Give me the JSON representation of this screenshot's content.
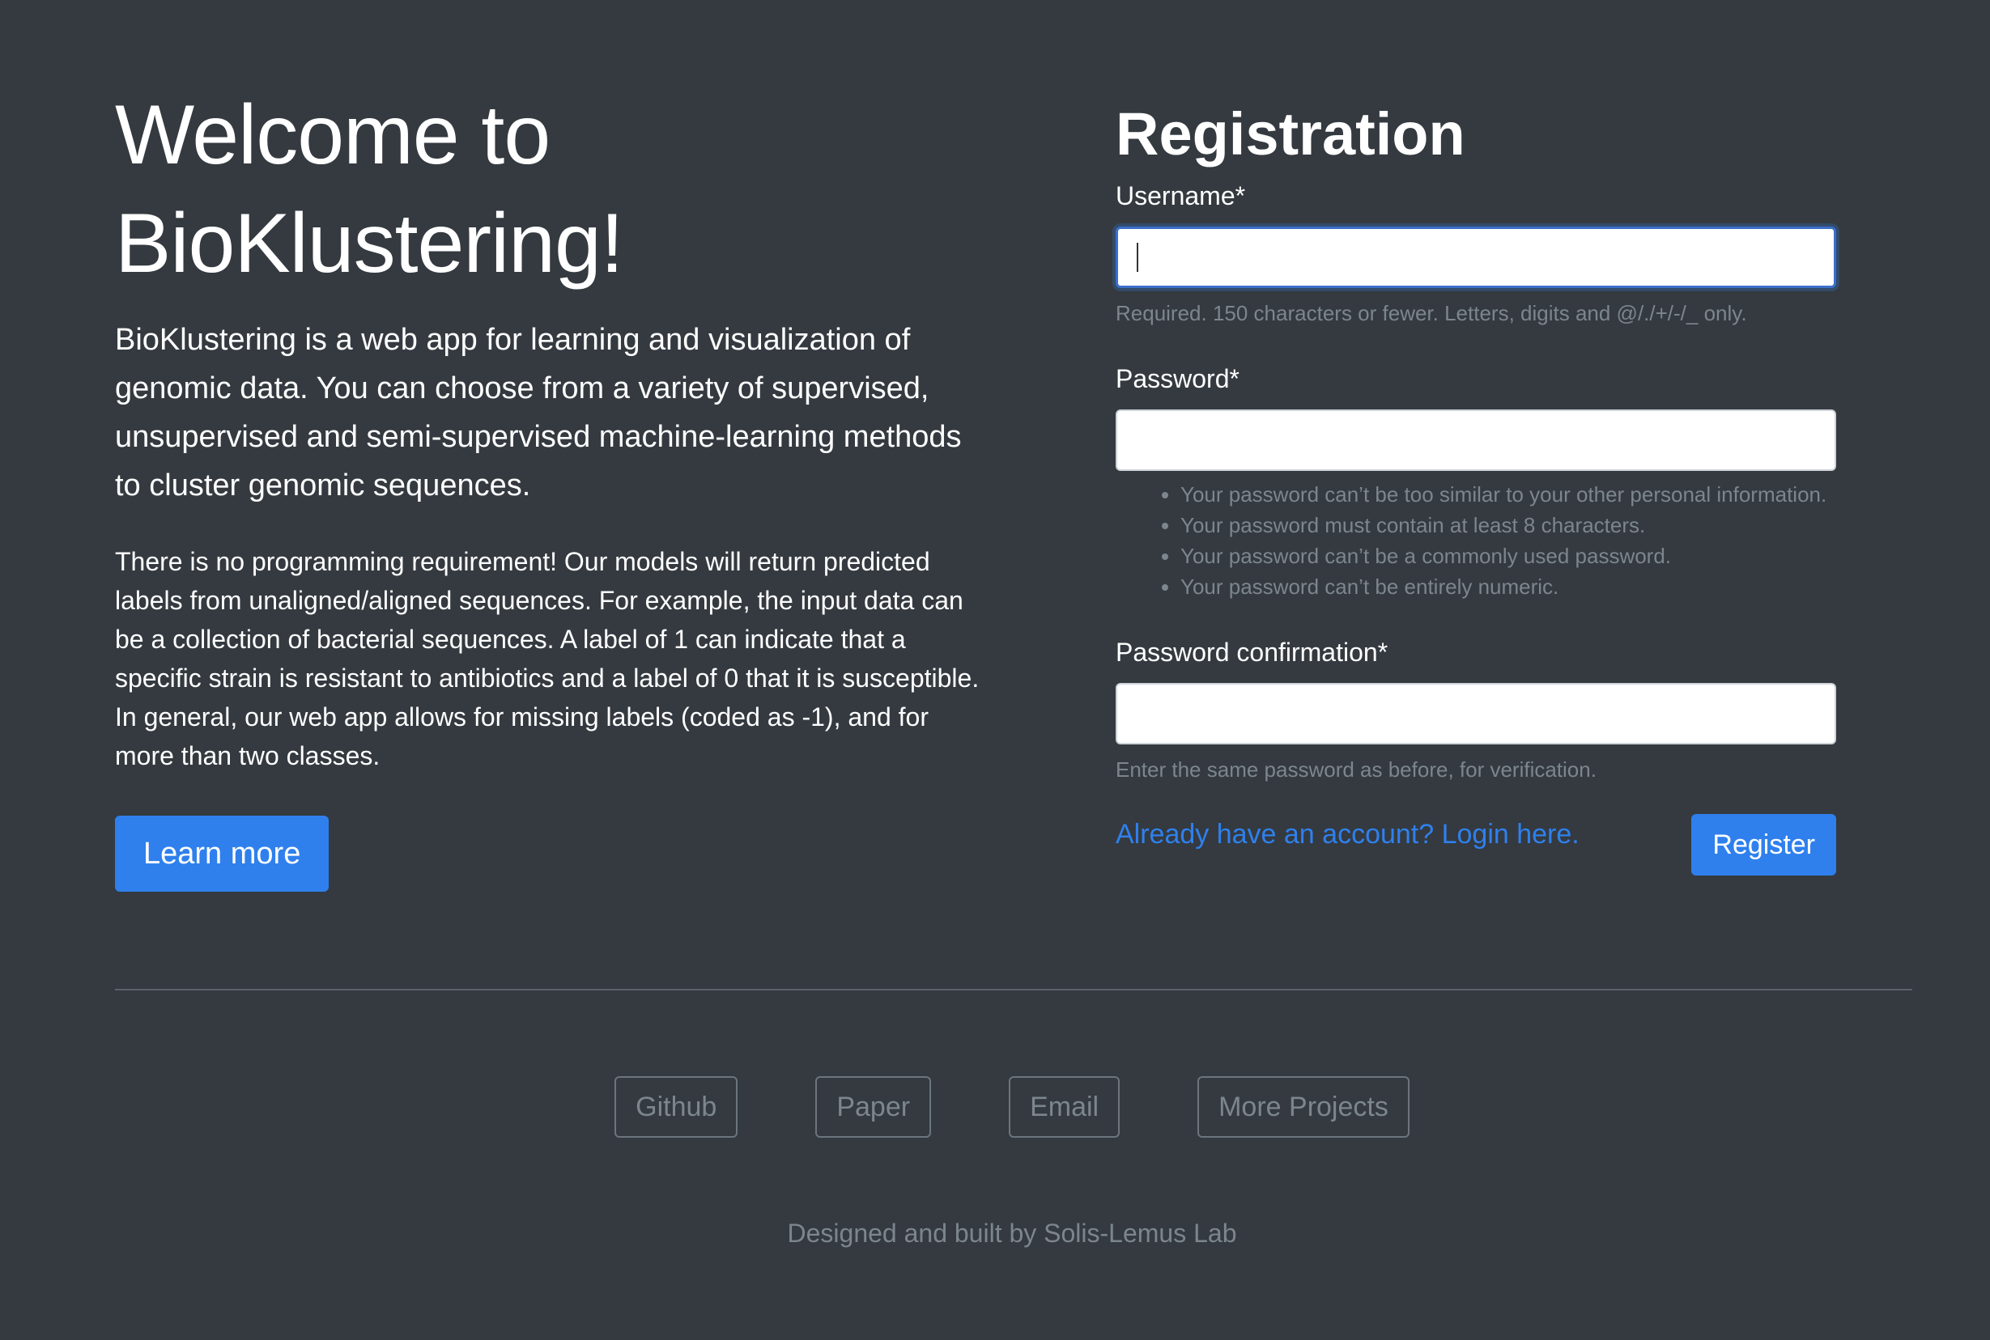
{
  "hero": {
    "title_line1": "Welcome to",
    "title_line2": "BioKlustering!",
    "lead": "BioKlustering is a web app for learning and visualization of genomic data. You can choose from a variety of supervised, unsupervised and semi-supervised machine-learning methods to cluster genomic sequences.",
    "body": "There is no programming requirement! Our models will return predicted labels from unaligned/aligned sequences. For example, the input data can be a collection of bacterial sequences. A label of 1 can indicate that a specific strain is resistant to antibiotics and a label of 0 that it is susceptible. In general, our web app allows for missing labels (coded as -1), and for more than two classes.",
    "learn_more_label": "Learn more"
  },
  "registration": {
    "title": "Registration",
    "username": {
      "label": "Username*",
      "value": "",
      "help": "Required. 150 characters or fewer. Letters, digits and @/./+/-/_ only."
    },
    "password": {
      "label": "Password*",
      "value": "",
      "help_items": [
        "Your password can’t be too similar to your other personal information.",
        "Your password must contain at least 8 characters.",
        "Your password can’t be a commonly used password.",
        "Your password can’t be entirely numeric."
      ]
    },
    "password_confirmation": {
      "label": "Password confirmation*",
      "value": "",
      "help": "Enter the same password as before, for verification."
    },
    "login_link": "Already have an account? Login here.",
    "register_label": "Register"
  },
  "footer": {
    "links": [
      "Github",
      "Paper",
      "Email",
      "More Projects"
    ],
    "credit": "Designed and built by Solis-Lemus Lab"
  },
  "colors": {
    "background": "#343a40",
    "accent": "#2f80ed",
    "muted_text": "#7d858d"
  }
}
